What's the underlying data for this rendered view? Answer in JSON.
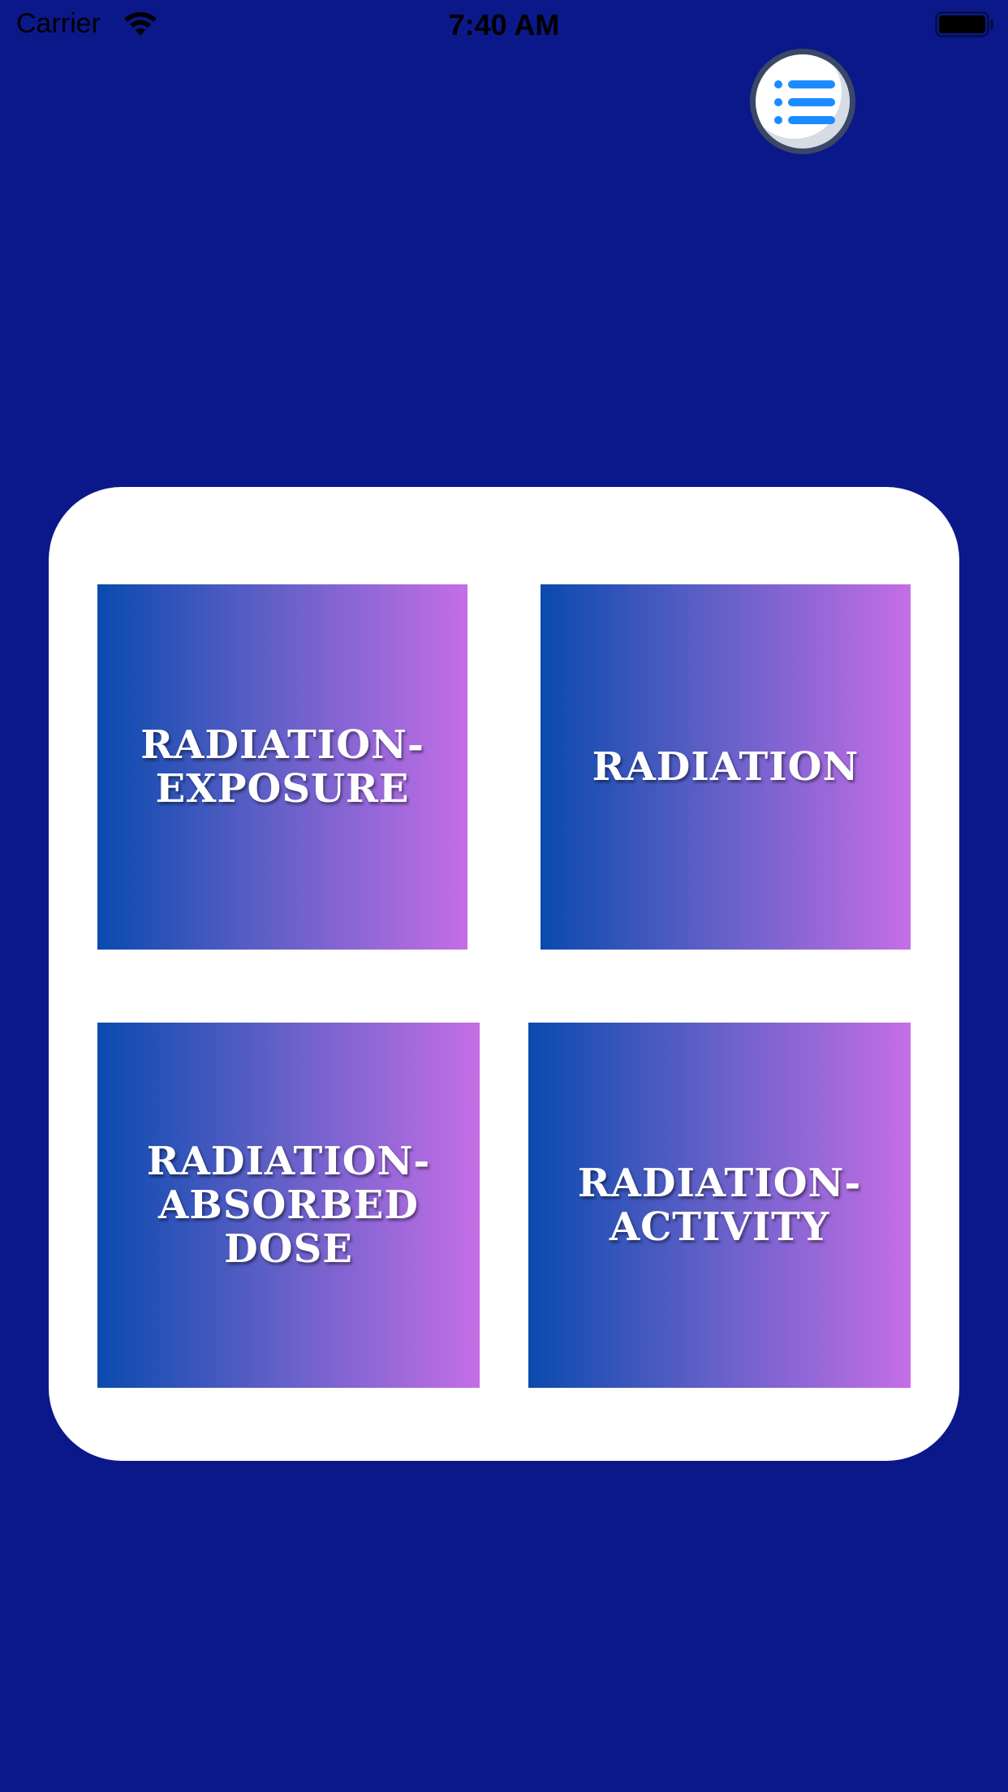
{
  "status_bar": {
    "carrier": "Carrier",
    "time": "7:40 AM",
    "wifi_icon": "wifi-icon",
    "battery_icon": "battery-full-icon"
  },
  "menu": {
    "icon": "list-menu-icon",
    "color": "#1a8cff"
  },
  "colors": {
    "background": "#0b1889",
    "card": "#ffffff",
    "gradient_start": "#0a4aae",
    "gradient_end": "#c56ee6"
  },
  "tiles": [
    {
      "label": "RADIATION-\nEXPOSURE"
    },
    {
      "label": "RADIATION"
    },
    {
      "label": "RADIATION-\nABSORBED\nDOSE"
    },
    {
      "label": "RADIATION-\nACTIVITY"
    }
  ]
}
